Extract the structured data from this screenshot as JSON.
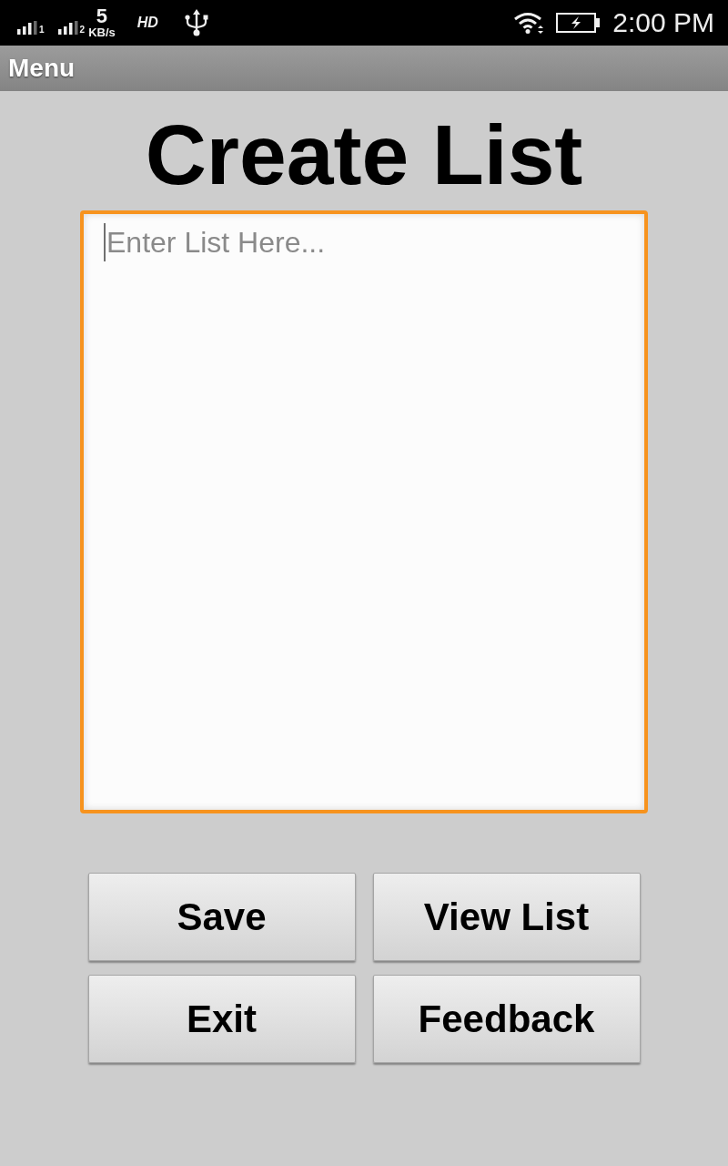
{
  "status_bar": {
    "sim_1_label": "1",
    "sim_2_label": "2",
    "data_speed": "5",
    "data_speed_unit": "KB/s",
    "network_type": "HD",
    "time": "2:00 PM"
  },
  "menu_bar": {
    "title": "Menu"
  },
  "title": "Create List",
  "list_field": {
    "placeholder": "Enter List Here...",
    "focused": true
  },
  "buttons": [
    "Save",
    "View List",
    "Exit",
    "Feedback"
  ]
}
